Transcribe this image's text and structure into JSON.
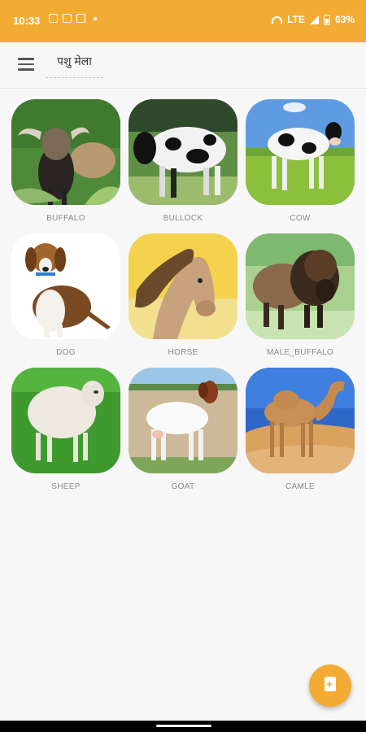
{
  "status_bar": {
    "time": "10:33",
    "network": "LTE",
    "battery": "63%"
  },
  "app_bar": {
    "title": "पशु मेला"
  },
  "animals": [
    {
      "label": "BUFFALO"
    },
    {
      "label": "BULLOCK"
    },
    {
      "label": "COW"
    },
    {
      "label": "DOG"
    },
    {
      "label": "HORSE"
    },
    {
      "label": "MALE_BUFFALO"
    },
    {
      "label": "SHEEP"
    },
    {
      "label": "GOAT"
    },
    {
      "label": "CAMLE"
    }
  ],
  "colors": {
    "accent": "#f2ac33",
    "background": "#f7f7f7",
    "label": "#8a8a8a"
  }
}
